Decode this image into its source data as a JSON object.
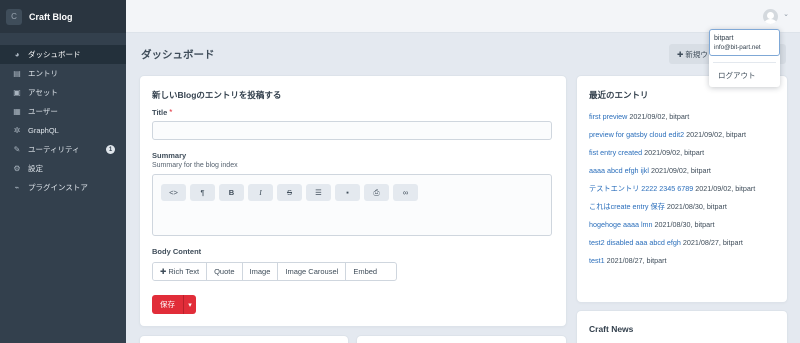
{
  "brand": {
    "logo_letter": "C",
    "name": "Craft Blog"
  },
  "sidebar": {
    "items": [
      {
        "icon": "◕",
        "label": "ダッシュボード",
        "active": true
      },
      {
        "icon": "▤",
        "label": "エントリ"
      },
      {
        "icon": "▣",
        "label": "アセット"
      },
      {
        "icon": "▦",
        "label": "ユーザー"
      },
      {
        "icon": "✲",
        "label": "GraphQL"
      },
      {
        "icon": "✎",
        "label": "ユーティリティ",
        "badge": "1"
      },
      {
        "icon": "⚙",
        "label": "設定"
      },
      {
        "icon": "⌁",
        "label": "プラグインストア"
      }
    ]
  },
  "header": {
    "page_title": "ダッシュボード",
    "new_widget_label": "✚ 新規ウィジェット"
  },
  "user_menu": {
    "name": "bitpart",
    "email": "info@bit-part.net",
    "logout_label": "ログアウト"
  },
  "new_entry": {
    "title": "新しいBlogのエントリを投稿する",
    "title_field_label": "Title",
    "required_mark": "*",
    "summary_label": "Summary",
    "summary_instructions": "Summary for the blog index",
    "body_label": "Body Content",
    "toolbar": [
      "<>",
      "¶",
      "B",
      "I",
      "S",
      "☰",
      "▪",
      "⎙",
      "∞"
    ],
    "block_types": [
      "✚ Rich Text",
      "Quote",
      "Image",
      "Image Carousel",
      "Embed"
    ],
    "save_label": "保存",
    "save_menu_icon": "▾"
  },
  "recent_entries": {
    "title": "最近のエントリ",
    "items": [
      {
        "title": "first preview",
        "meta": "2021/09/02, bitpart"
      },
      {
        "title": "preview for gatsby cloud edit2",
        "meta": "2021/09/02, bitpart"
      },
      {
        "title": "fist entry created",
        "meta": "2021/09/02, bitpart"
      },
      {
        "title": "aaaa abcd efgh ijkl",
        "meta": "2021/09/02, bitpart"
      },
      {
        "title": "テストエントリ 2222 2345 6789",
        "meta": "2021/09/02, bitpart"
      },
      {
        "title": "これはcreate entry 保存",
        "meta": "2021/08/30, bitpart"
      },
      {
        "title": "hogehoge aaaa lmn",
        "meta": "2021/08/30, bitpart"
      },
      {
        "title": "test2 disabled aaa abcd efgh",
        "meta": "2021/08/27, bitpart"
      },
      {
        "title": "test1",
        "meta": "2021/08/27, bitpart"
      }
    ]
  },
  "craft_news": {
    "title": "Craft News"
  },
  "colors": {
    "sidebar": "#33404d",
    "accent_red": "#e12d39",
    "link": "#2a6ebb",
    "background": "#e4e9f0"
  }
}
